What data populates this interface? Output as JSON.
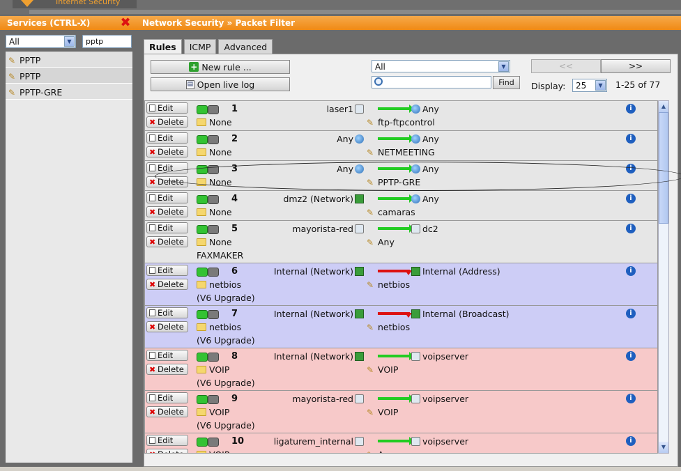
{
  "brand": "Internet Security",
  "left_panel": {
    "title": "Services (CTRL-X)",
    "filter_value": "All",
    "search_value": "pptp",
    "items": [
      {
        "label": "PPTP"
      },
      {
        "label": "PPTP"
      },
      {
        "label": "PPTP-GRE"
      }
    ]
  },
  "main": {
    "title": "Network Security » Packet Filter",
    "tabs": [
      {
        "label": "Rules",
        "active": true
      },
      {
        "label": "ICMP",
        "active": false
      },
      {
        "label": "Advanced",
        "active": false
      }
    ],
    "new_rule_label": "New rule ...",
    "open_log_label": "Open live log",
    "group_filter_value": "All",
    "search_value": "",
    "find_label": "Find",
    "pager_prev": "<<",
    "pager_next": ">>",
    "display_label": "Display:",
    "display_value": "25",
    "range_text": "1-25 of 77",
    "edit_label": "Edit",
    "delete_label": "Delete"
  },
  "rules": [
    {
      "num": "1",
      "source": "laser1",
      "source_icon": "host-icon",
      "dest": "Any",
      "dest_icon": "globe-icon",
      "group": "None",
      "service": "ftp-ftpcontrol",
      "extra": "",
      "color": "gray",
      "action": "allow"
    },
    {
      "num": "2",
      "source": "Any",
      "source_icon": "globe-icon",
      "dest": "Any",
      "dest_icon": "globe-icon",
      "group": "None",
      "service": "NETMEETING",
      "extra": "",
      "color": "gray",
      "action": "allow"
    },
    {
      "num": "3",
      "source": "Any",
      "source_icon": "globe-icon",
      "dest": "Any",
      "dest_icon": "globe-icon",
      "group": "None",
      "service": "PPTP-GRE",
      "extra": "",
      "color": "gray",
      "action": "allow"
    },
    {
      "num": "4",
      "source": "dmz2 (Network)",
      "source_icon": "network-icon",
      "dest": "Any",
      "dest_icon": "globe-icon",
      "group": "None",
      "service": "camaras",
      "extra": "",
      "color": "gray",
      "action": "allow"
    },
    {
      "num": "5",
      "source": "mayorista-red",
      "source_icon": "host-icon",
      "dest": "dc2",
      "dest_icon": "host-icon",
      "group": "None",
      "service": "Any",
      "extra": "FAXMAKER",
      "color": "gray",
      "action": "allow"
    },
    {
      "num": "6",
      "source": "Internal (Network)",
      "source_icon": "network-icon",
      "dest": "Internal (Address)",
      "dest_icon": "network-icon",
      "group": "netbios",
      "service": "netbios",
      "extra": "(V6 Upgrade)",
      "color": "blue",
      "action": "drop"
    },
    {
      "num": "7",
      "source": "Internal (Network)",
      "source_icon": "network-icon",
      "dest": "Internal (Broadcast)",
      "dest_icon": "network-icon",
      "group": "netbios",
      "service": "netbios",
      "extra": "(V6 Upgrade)",
      "color": "blue",
      "action": "drop"
    },
    {
      "num": "8",
      "source": "Internal (Network)",
      "source_icon": "network-icon",
      "dest": "voipserver",
      "dest_icon": "host-icon",
      "group": "VOIP",
      "service": "VOIP",
      "extra": "(V6 Upgrade)",
      "color": "red",
      "action": "allow"
    },
    {
      "num": "9",
      "source": "mayorista-red",
      "source_icon": "host-icon",
      "dest": "voipserver",
      "dest_icon": "host-icon",
      "group": "VOIP",
      "service": "VOIP",
      "extra": "(V6 Upgrade)",
      "color": "red",
      "action": "allow"
    },
    {
      "num": "10",
      "source": "ligaturem_internal",
      "source_icon": "host-icon",
      "dest": "voipserver",
      "dest_icon": "host-icon",
      "group": "VOIP",
      "service": "Any",
      "extra": "",
      "color": "red",
      "action": "allow"
    }
  ],
  "colors": {
    "orange_header": "#f08a14",
    "row_gray": "#e6e6e6",
    "row_blue": "#cdcdf6",
    "row_red": "#f7c9c9",
    "allow_arrow": "#22cc22",
    "drop_arrow": "#d11111"
  }
}
